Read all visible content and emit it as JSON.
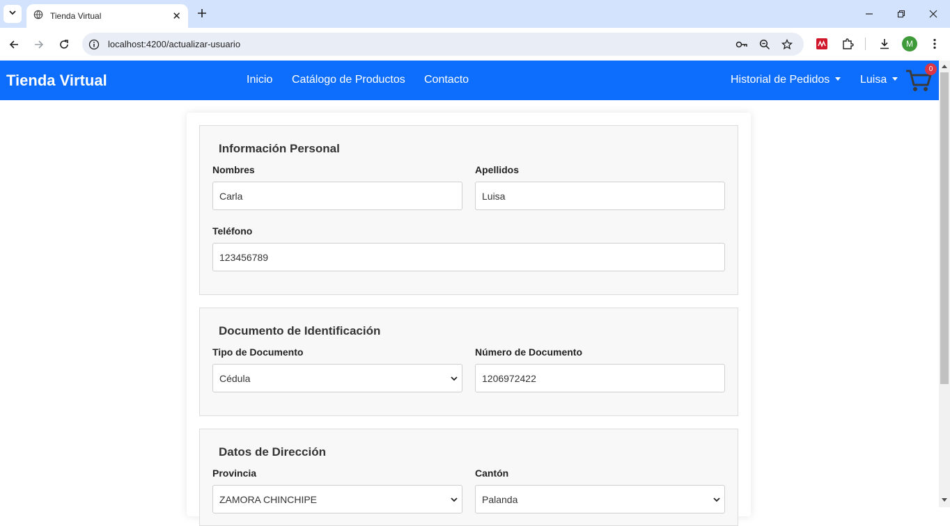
{
  "browser": {
    "tab_title": "Tienda Virtual",
    "url": "localhost:4200/actualizar-usuario",
    "profile_initial": "M"
  },
  "navbar": {
    "brand": "Tienda Virtual",
    "links": [
      "Inicio",
      "Catálogo de Productos",
      "Contacto"
    ],
    "history_label": "Historial de Pedidos",
    "user_label": "Luisa",
    "cart_count": "0"
  },
  "form": {
    "personal": {
      "legend": "Información Personal",
      "first_name_label": "Nombres",
      "first_name_value": "Carla",
      "last_name_label": "Apellidos",
      "last_name_value": "Luisa",
      "phone_label": "Teléfono",
      "phone_value": "123456789"
    },
    "document": {
      "legend": "Documento de Identificación",
      "type_label": "Tipo de Documento",
      "type_value": "Cédula",
      "number_label": "Número de Documento",
      "number_value": "1206972422"
    },
    "address": {
      "legend": "Datos de Dirección",
      "province_label": "Provincia",
      "province_value": "ZAMORA CHINCHIPE",
      "canton_label": "Cantón",
      "canton_value": "Palanda"
    }
  },
  "colors": {
    "navbar": "#0d6efd",
    "tabbar": "#d3e3fd",
    "badge": "#dc3545"
  }
}
